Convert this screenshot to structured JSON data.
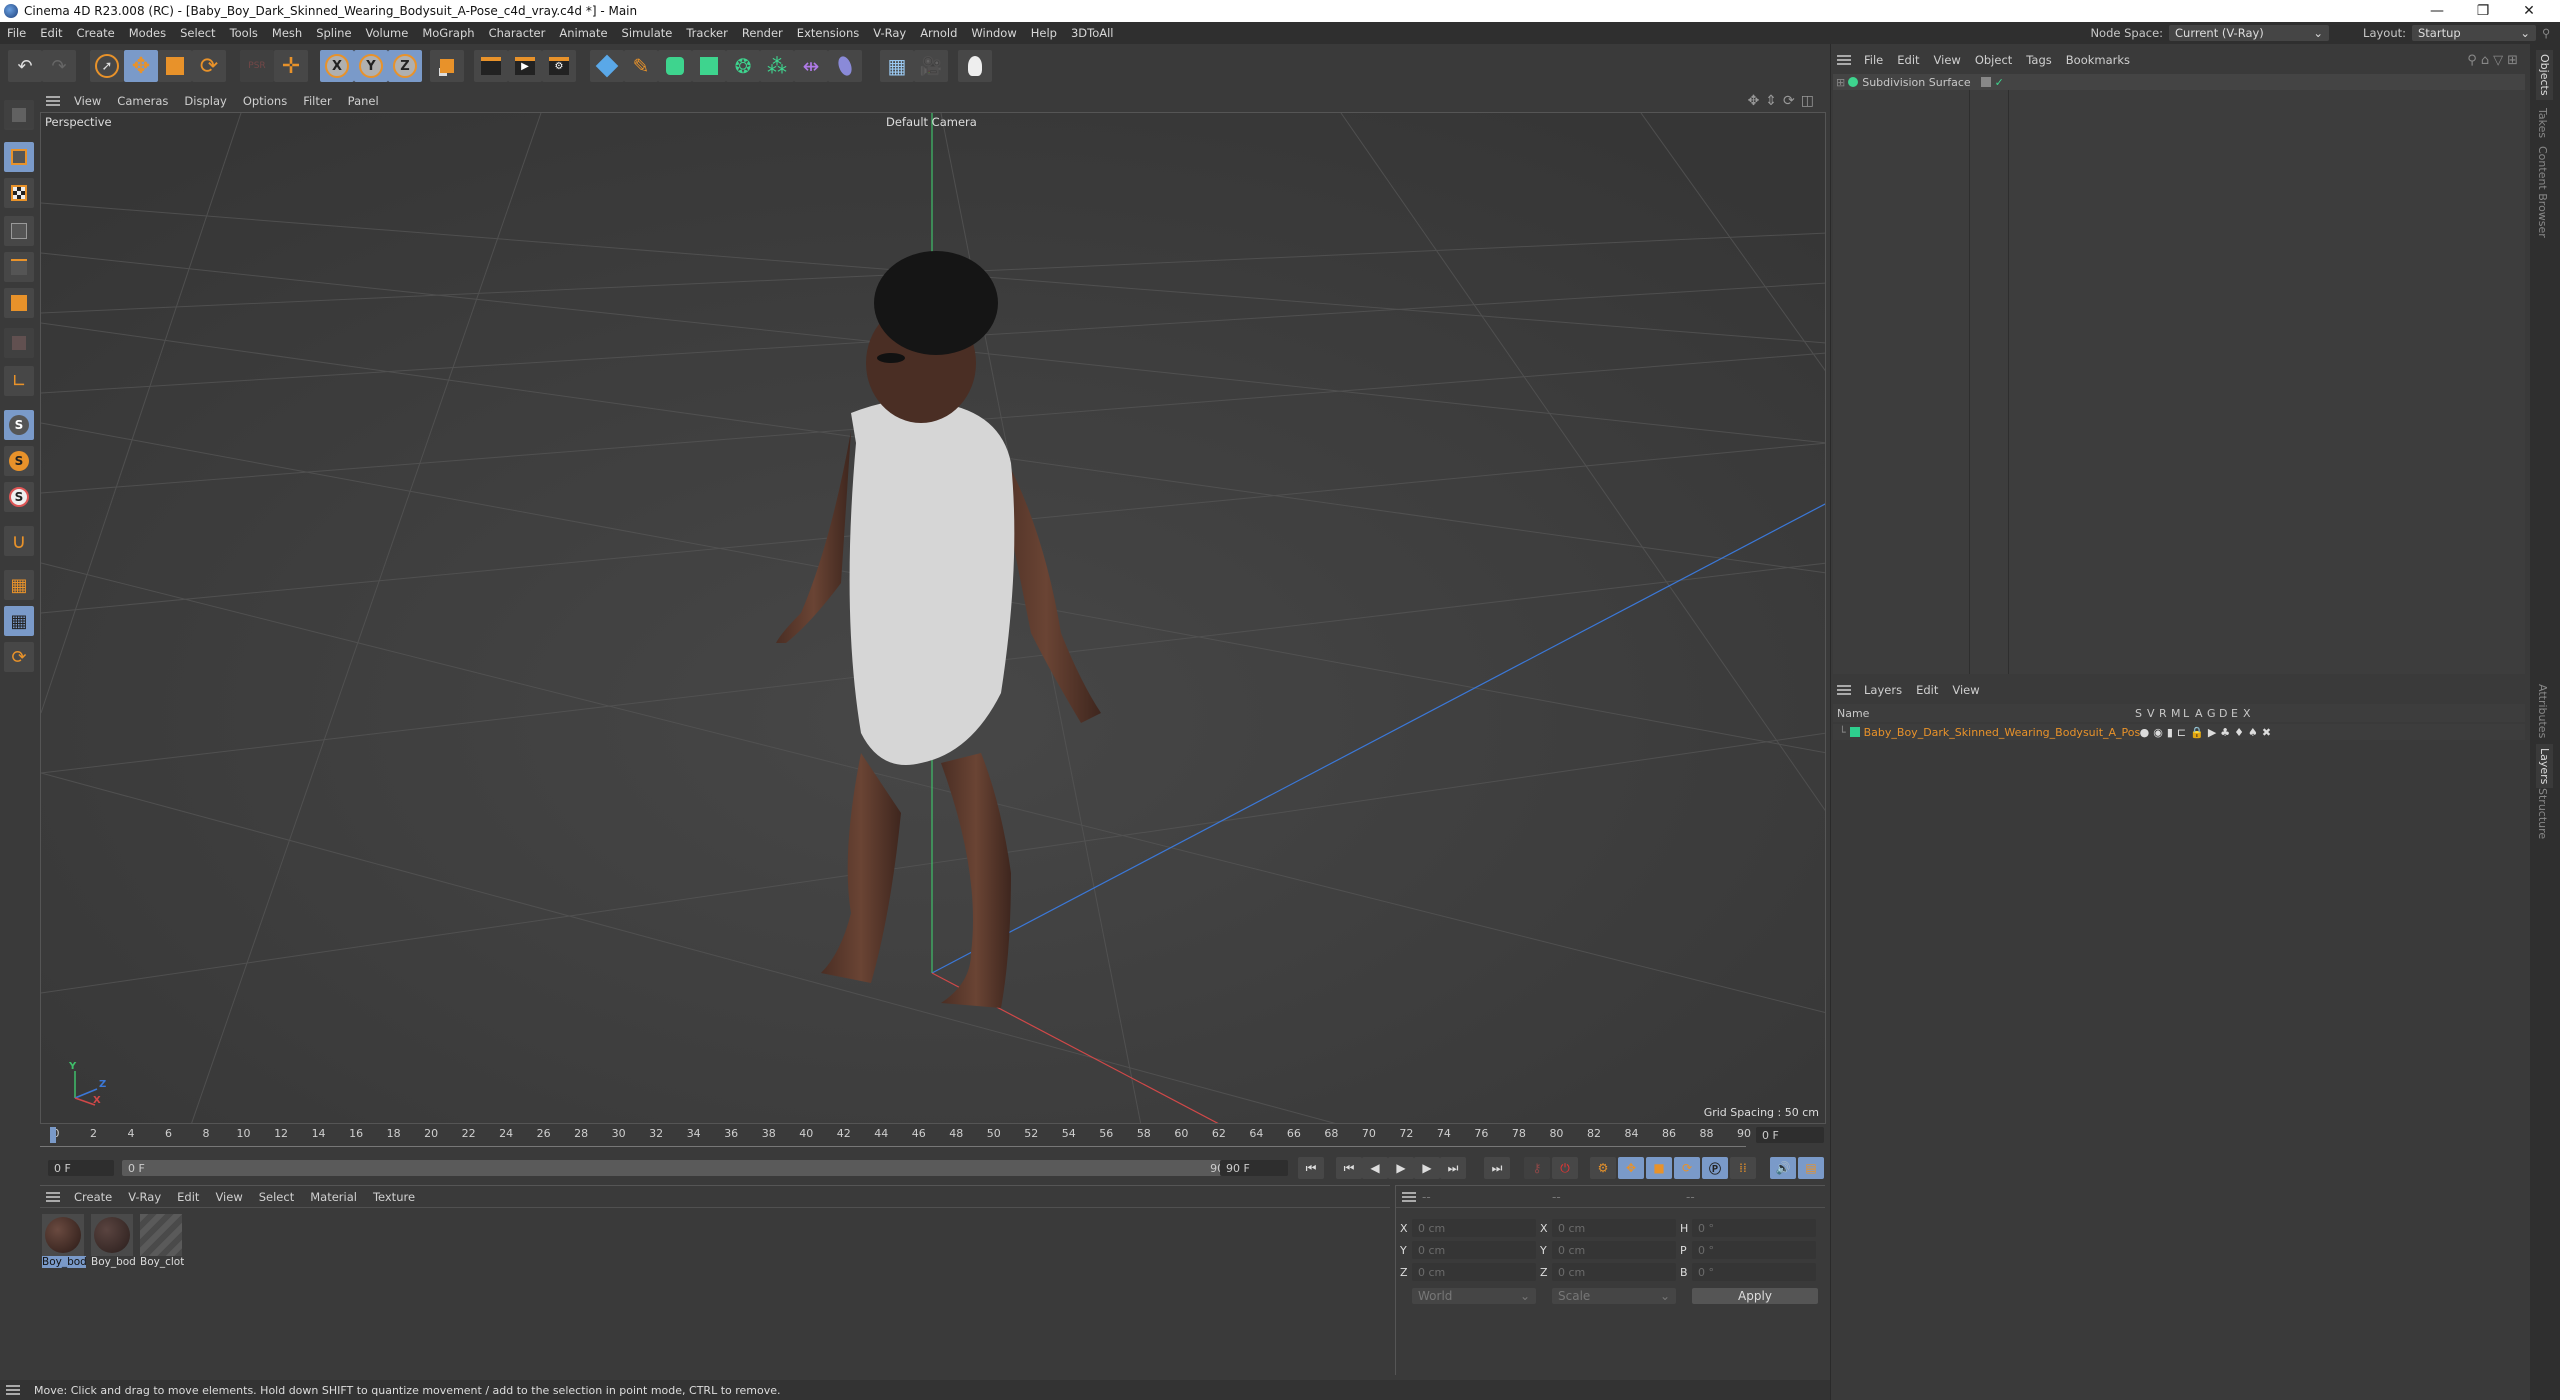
{
  "window": {
    "title": "Cinema 4D R23.008 (RC) - [Baby_Boy_Dark_Skinned_Wearing_Bodysuit_A-Pose_c4d_vray.c4d *] - Main",
    "controls": {
      "minimize": "—",
      "maximize": "❐",
      "close": "✕"
    }
  },
  "menubar": {
    "items": [
      "File",
      "Edit",
      "Create",
      "Modes",
      "Select",
      "Tools",
      "Mesh",
      "Spline",
      "Volume",
      "MoGraph",
      "Character",
      "Animate",
      "Simulate",
      "Tracker",
      "Render",
      "Extensions",
      "V-Ray",
      "Arnold",
      "Window",
      "Help",
      "3DToAll"
    ],
    "node_space_label": "Node Space:",
    "node_space_value": "Current (V-Ray)",
    "layout_label": "Layout:",
    "layout_value": "Startup"
  },
  "toolbar": {
    "icons": [
      "undo-icon",
      "redo-icon",
      "select-icon",
      "move-icon",
      "scale-icon",
      "rotate-icon",
      "psr-icon",
      "add-icon",
      "x-axis-icon",
      "y-axis-icon",
      "z-axis-icon",
      "coordinate-system-icon",
      "render-view-icon",
      "render-icon",
      "render-settings-icon",
      "cube-icon",
      "pen-icon",
      "subdivision-icon",
      "extrude-icon",
      "cloner-icon",
      "array-icon",
      "deformer-icon",
      "sky-icon",
      "floor-icon",
      "camera-icon",
      "light-icon"
    ],
    "axis_labels": [
      "X",
      "Y",
      "Z"
    ]
  },
  "viewport": {
    "menu": [
      "View",
      "Cameras",
      "Display",
      "Options",
      "Filter",
      "Panel"
    ],
    "projection": "Perspective",
    "camera": "Default Camera",
    "grid_spacing": "Grid Spacing : 50 cm",
    "axis_labels": {
      "x": "X",
      "y": "Y",
      "z": "Z"
    }
  },
  "timeline": {
    "ticks": [
      "0",
      "2",
      "4",
      "6",
      "8",
      "10",
      "12",
      "14",
      "16",
      "18",
      "20",
      "22",
      "24",
      "26",
      "28",
      "30",
      "32",
      "34",
      "36",
      "38",
      "40",
      "42",
      "44",
      "46",
      "48",
      "50",
      "52",
      "54",
      "56",
      "58",
      "60",
      "62",
      "64",
      "66",
      "68",
      "70",
      "72",
      "74",
      "76",
      "78",
      "80",
      "82",
      "84",
      "86",
      "88",
      "90"
    ],
    "current_frame": "0 F",
    "start_frame": "0 F",
    "range_start": "0 F",
    "range_end": "90 F",
    "end_frame": "90 F"
  },
  "materials": {
    "menu": [
      "Create",
      "V-Ray",
      "Edit",
      "View",
      "Select",
      "Material",
      "Texture"
    ],
    "items": [
      {
        "label": "Boy_bod",
        "selected": true
      },
      {
        "label": "Boy_bod",
        "selected": false
      },
      {
        "label": "Boy_clot",
        "selected": false
      }
    ]
  },
  "coordinates": {
    "headers": [
      "--",
      "--",
      "--"
    ],
    "rows": [
      {
        "l1": "X",
        "v1": "0 cm",
        "l2": "X",
        "v2": "0 cm",
        "l3": "H",
        "v3": "0 °"
      },
      {
        "l1": "Y",
        "v1": "0 cm",
        "l2": "Y",
        "v2": "0 cm",
        "l3": "P",
        "v3": "0 °"
      },
      {
        "l1": "Z",
        "v1": "0 cm",
        "l2": "Z",
        "v2": "0 cm",
        "l3": "B",
        "v3": "0 °"
      }
    ],
    "space": "World",
    "mode": "Scale",
    "apply": "Apply"
  },
  "objects": {
    "menu": [
      "File",
      "Edit",
      "View",
      "Object",
      "Tags",
      "Bookmarks"
    ],
    "items": [
      {
        "name": "Subdivision Surface"
      }
    ]
  },
  "layers": {
    "menu": [
      "Layers",
      "Edit",
      "View"
    ],
    "name_header": "Name",
    "flag_headers": [
      "S",
      "V",
      "R",
      "M",
      "L",
      "A",
      "G",
      "D",
      "E",
      "X"
    ],
    "items": [
      {
        "name": "Baby_Boy_Dark_Skinned_Wearing_Bodysuit_A_Pose",
        "color": "#2ecf8e"
      }
    ]
  },
  "side_tabs": {
    "top": [
      "Objects",
      "Takes",
      "Content Browser"
    ],
    "bottom": [
      "Attributes",
      "Layers",
      "Structure"
    ]
  },
  "status": "Move: Click and drag to move elements. Hold down SHIFT to quantize movement / add to the selection in point mode, CTRL to remove.",
  "colors": {
    "accent": "#e8922a",
    "selected": "#7a9ac9",
    "layer_text": "#e8922a"
  }
}
